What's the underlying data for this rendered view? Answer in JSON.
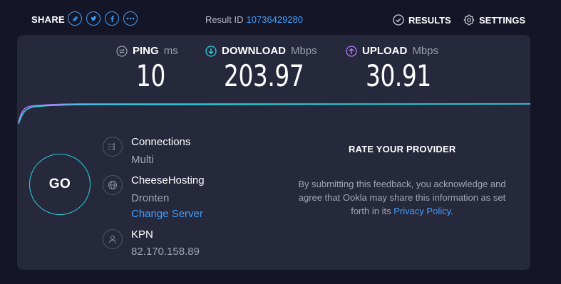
{
  "header": {
    "share_label": "SHARE",
    "share_icons": [
      "link-icon",
      "twitter-icon",
      "facebook-icon",
      "more-icon"
    ],
    "result_label": "Result ID",
    "result_id": "10736429280",
    "results_label": "RESULTS",
    "settings_label": "SETTINGS"
  },
  "metrics": {
    "ping": {
      "label": "PING",
      "unit": "ms",
      "value": "10"
    },
    "download": {
      "label": "DOWNLOAD",
      "unit": "Mbps",
      "value": "203.97"
    },
    "upload": {
      "label": "UPLOAD",
      "unit": "Mbps",
      "value": "30.91"
    }
  },
  "go_label": "GO",
  "connections": {
    "title": "Connections",
    "value": "Multi"
  },
  "server": {
    "name": "CheeseHosting",
    "location": "Dronten",
    "change_label": "Change Server"
  },
  "isp": {
    "name": "KPN",
    "ip": "82.170.158.89"
  },
  "rate": {
    "title": "RATE YOUR PROVIDER",
    "text": "By submitting this feedback, you acknowledge and agree that Ookla may share this information as set forth in its",
    "link": "Privacy Policy",
    "suffix": "."
  },
  "colors": {
    "accent": "#3fa0ff",
    "go_ring": "#2ad3e0",
    "download": "#2ad3e0",
    "upload": "#b67cff",
    "panel": "#26283c",
    "background": "#141526"
  }
}
